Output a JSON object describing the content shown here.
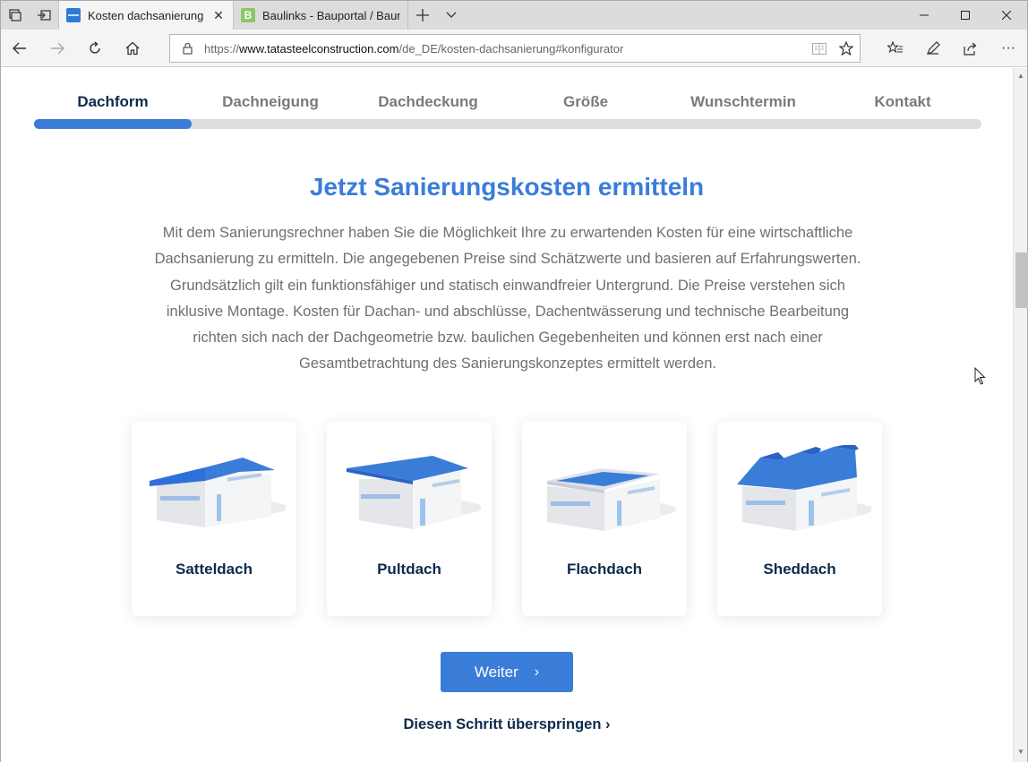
{
  "browser": {
    "tabs": [
      {
        "title": "Kosten dachsanierung",
        "active": true,
        "favicon": "tata-steel-favicon"
      },
      {
        "title": "Baulinks - Bauportal / Baum",
        "active": false,
        "favicon": "baulinks-favicon"
      }
    ],
    "favicon_letter": "B",
    "url_prefix": "https://",
    "url_host": "www.tatasteelconstruction.com",
    "url_path": "/de_DE/kosten-dachsanierung#konfigurator",
    "more_label": "···"
  },
  "steps": {
    "items": [
      "Dachform",
      "Dachneigung",
      "Dachdeckung",
      "Größe",
      "Wunschtermin",
      "Kontakt"
    ],
    "active_index": 0,
    "progress_fraction": 0.1667
  },
  "page": {
    "headline": "Jetzt Sanierungskosten ermitteln",
    "intro": "Mit dem Sanierungsrechner haben Sie die Möglichkeit Ihre zu erwartenden Kosten für eine wirtschaftliche Dachsanierung zu ermitteln. Die angegebenen Preise sind Schätzwerte und basieren auf Erfahrungswerten. Grundsätzlich gilt ein funktionsfähiger und statisch einwandfreier Untergrund. Die Preise verstehen sich inklusive Montage. Kosten für Dachan- und abschlüsse, Dachentwässerung und technische Bearbeitung richten sich nach der Dachgeometrie bzw. baulichen Gegebenheiten und können erst nach einer Gesamtbetrachtung des Sanierungskonzeptes ermittelt werden.",
    "roof_options": [
      {
        "label": "Satteldach",
        "icon": "gable-roof-building-icon"
      },
      {
        "label": "Pultdach",
        "icon": "mono-pitch-roof-building-icon"
      },
      {
        "label": "Flachdach",
        "icon": "flat-roof-building-icon"
      },
      {
        "label": "Sheddach",
        "icon": "sawtooth-roof-building-icon"
      }
    ],
    "next_button": "Weiter",
    "next_chevron": "›",
    "skip_link": "Diesen Schritt überspringen ›"
  },
  "colors": {
    "accent": "#3a7dd8",
    "navy": "#0c2b4a",
    "muted_text": "#6f6f6f",
    "track": "#dedede"
  }
}
